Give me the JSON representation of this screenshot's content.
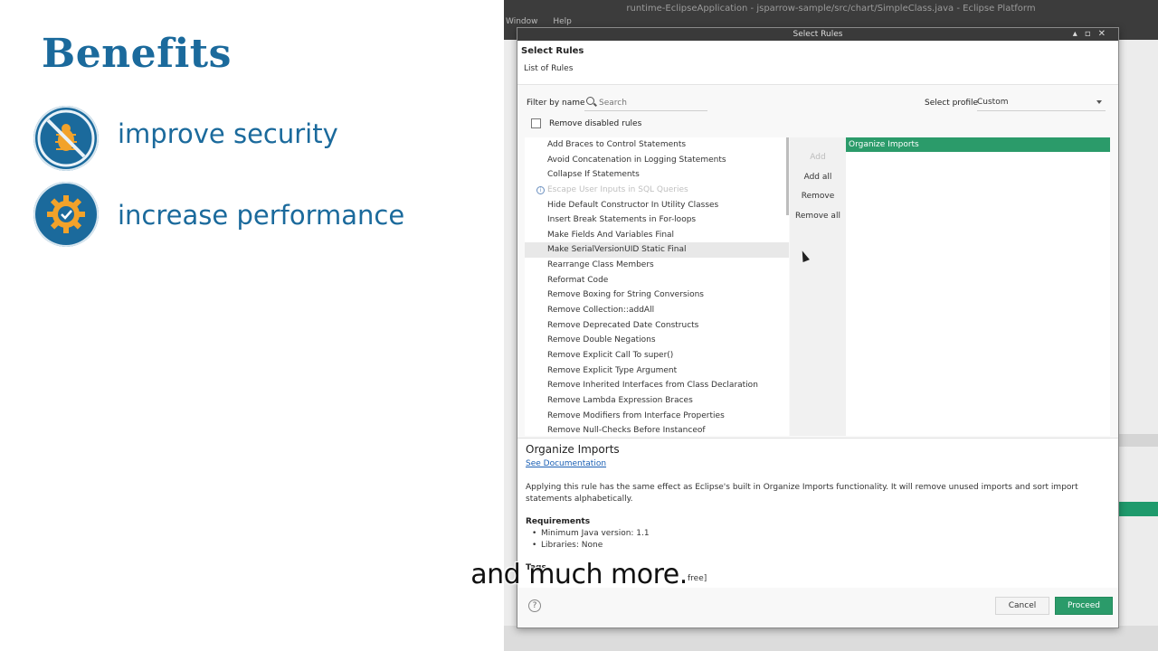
{
  "slide": {
    "title": "Benefits",
    "benefits": [
      {
        "label": "improve security",
        "icon": "no-bug-icon"
      },
      {
        "label": "increase performance",
        "icon": "gear-check-icon"
      }
    ],
    "colors": {
      "accent": "#1b6a9c"
    }
  },
  "eclipse": {
    "window_title": "runtime-EclipseApplication - jsparrow-sample/src/chart/SimpleClass.java - Eclipse Platform",
    "menu": [
      "Window",
      "Help"
    ]
  },
  "dialog": {
    "title": "Select Rules",
    "header_title": "Select Rules",
    "header_subtitle": "List of Rules",
    "filter_label": "Filter by name",
    "search_placeholder": "Search",
    "profile_label": "Select profile",
    "profile_value": "Custom",
    "remove_disabled_label": "Remove disabled rules",
    "rules": [
      {
        "label": "Add Braces to Control Statements"
      },
      {
        "label": "Avoid Concatenation in Logging Statements"
      },
      {
        "label": "Collapse If Statements"
      },
      {
        "label": "Escape User Inputs in SQL Queries",
        "disabled": true
      },
      {
        "label": "Hide Default Constructor In Utility Classes"
      },
      {
        "label": "Insert Break Statements in For-loops"
      },
      {
        "label": "Make Fields And Variables Final"
      },
      {
        "label": "Make SerialVersionUID Static Final",
        "selected": true
      },
      {
        "label": "Rearrange Class Members"
      },
      {
        "label": "Reformat Code"
      },
      {
        "label": "Remove Boxing for String Conversions"
      },
      {
        "label": "Remove Collection::addAll"
      },
      {
        "label": "Remove Deprecated Date Constructs"
      },
      {
        "label": "Remove Double Negations"
      },
      {
        "label": "Remove Explicit Call To super()"
      },
      {
        "label": "Remove Explicit Type Argument"
      },
      {
        "label": "Remove Inherited Interfaces from Class Declaration"
      },
      {
        "label": "Remove Lambda Expression Braces"
      },
      {
        "label": "Remove Modifiers from Interface Properties"
      },
      {
        "label": "Remove Null-Checks Before Instanceof"
      }
    ],
    "buttons": {
      "add": "Add",
      "add_all": "Add all",
      "remove": "Remove",
      "remove_all": "Remove all"
    },
    "selected_rules": [
      "Organize Imports"
    ],
    "description": {
      "title": "Organize Imports",
      "link": "See Documentation",
      "text": "Applying this rule has the same effect as Eclipse's built in Organize Imports functionality. It will remove unused imports and sort import statements alphabetically.",
      "requirements_title": "Requirements",
      "requirements": [
        "Minimum Java version: 1.1",
        "Libraries: None"
      ],
      "tags_title": "Tags",
      "tags": "free]"
    },
    "footer": {
      "cancel": "Cancel",
      "proceed": "Proceed"
    },
    "colors": {
      "green": "#2b9b6a"
    }
  },
  "caption": "and much more."
}
